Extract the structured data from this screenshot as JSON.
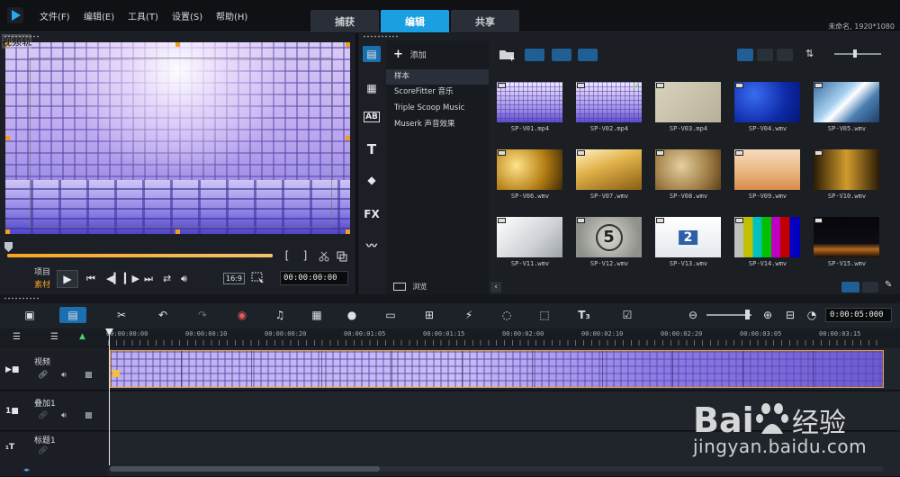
{
  "menu": [
    "文件(F)",
    "编辑(E)",
    "工具(T)",
    "设置(S)",
    "帮助(H)"
  ],
  "tabs": [
    {
      "label": "捕获",
      "active": false
    },
    {
      "label": "编辑",
      "active": true
    },
    {
      "label": "共享",
      "active": false
    }
  ],
  "project_info": "未命名, 1920*1080",
  "player": {
    "track_label": "视频轨",
    "scope": [
      "项目",
      "素材"
    ],
    "aspect": "16:9",
    "timecode": "00:00:00:00",
    "mark_in": "[",
    "mark_out": "]"
  },
  "library": {
    "add_label": "添加",
    "browse_label": "浏览",
    "folders": [
      "样本",
      "ScoreFitter 音乐",
      "Triple Scoop Music",
      "Muserk 声音效果"
    ],
    "selected_folder": 0,
    "side_icons": [
      "media-icon",
      "instant-project-icon",
      "transition-icon",
      "title-icon",
      "graphic-icon",
      "fx-icon",
      "path-icon"
    ],
    "side_text": {
      "transition": "AB",
      "title": "T",
      "fx": "FX"
    },
    "thumbnails": [
      {
        "label": "SP-V01.mp4",
        "style": "purple",
        "checked": false
      },
      {
        "label": "SP-V02.mp4",
        "style": "purple",
        "checked": true
      },
      {
        "label": "SP-V03.mp4",
        "style": "beige",
        "checked": false
      },
      {
        "label": "SP-V04.wmv",
        "style": "blue",
        "checked": false
      },
      {
        "label": "SP-V05.wmv",
        "style": "steel",
        "checked": false
      },
      {
        "label": "SP-V06.wmv",
        "style": "gold",
        "checked": false
      },
      {
        "label": "SP-V07.wmv",
        "style": "gold2",
        "checked": false
      },
      {
        "label": "SP-V08.wmv",
        "style": "sepia",
        "checked": false
      },
      {
        "label": "SP-V09.wmv",
        "style": "peach",
        "checked": false
      },
      {
        "label": "SP-V10.wmv",
        "style": "film",
        "checked": false
      },
      {
        "label": "SP-V11.wmv",
        "style": "white",
        "checked": false
      },
      {
        "label": "SP-V12.wmv",
        "style": "countdown",
        "checked": false
      },
      {
        "label": "SP-V13.wmv",
        "style": "screen",
        "checked": false
      },
      {
        "label": "SP-V14.wmv",
        "style": "bars",
        "checked": false
      },
      {
        "label": "SP-V15.wmv",
        "style": "night",
        "checked": false
      }
    ],
    "countdown_digit": "5",
    "screen_digit": "2"
  },
  "timeline": {
    "timecode": "0:00:05:000",
    "ruler": [
      "00:00:00:00",
      "00:00:00:10",
      "00:00:00:20",
      "00:00:01:05",
      "00:00:01:15",
      "00:00:02:00",
      "00:00:02:10",
      "00:00:02:20",
      "00:00:03:05",
      "00:00:03:15"
    ],
    "tracks": [
      {
        "name": "视频",
        "icon": "video-track-icon"
      },
      {
        "name": "叠加1",
        "icon": "overlay-track-icon"
      },
      {
        "name": "标题1",
        "icon": "title-track-icon"
      }
    ]
  },
  "watermark": {
    "logo_text": "Bai度经验",
    "url": "jingyan.baidu.com"
  }
}
